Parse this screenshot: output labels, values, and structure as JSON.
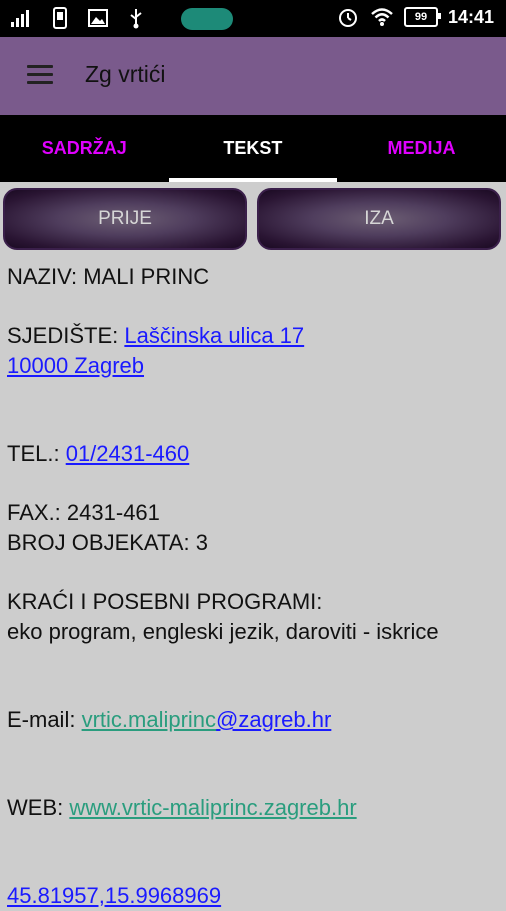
{
  "status_bar": {
    "time": "14:41",
    "battery": "99",
    "icons": [
      "signal-icon",
      "sim-icon",
      "image-icon",
      "usb-icon",
      "alarm-icon",
      "wifi-icon",
      "battery-icon"
    ]
  },
  "app_bar": {
    "title": "Zg vrtići",
    "menu_icon": "hamburger-menu-icon"
  },
  "tabs": [
    {
      "label": "SADRŽAJ",
      "selected": false
    },
    {
      "label": "TEKST",
      "selected": true
    },
    {
      "label": "MEDIJA",
      "selected": false
    }
  ],
  "nav_buttons": {
    "prev": "PRIJE",
    "next": "IZA"
  },
  "details": {
    "name_label": "NAZIV:",
    "name_value": "MALI PRINC",
    "seat_label": "SJEDIŠTE:",
    "seat_line1": "Laščinska ulica 17",
    "seat_line2": "10000 Zagreb",
    "tel_label": "TEL.:",
    "tel_value": "01/2431-460",
    "fax_label": "FAX.:",
    "fax_value": "2431-461",
    "objects_label": "BROJ OBJEKATA:",
    "objects_value": "3",
    "programs_label": "KRAĆI I POSEBNI PROGRAMI:",
    "programs_value": "eko program, engleski jezik, daroviti - iskrice",
    "email_label": "E-mail:",
    "email_part1": "vrtic.maliprinc",
    "email_part2": "@zagreb.hr",
    "web_label": "WEB:",
    "web_value": "www.vrtic-maliprinc.zagreb.hr",
    "coords": "45.81957,15.9968969"
  },
  "colors": {
    "status_bar": "#000000",
    "app_bar": "#7a5a8c",
    "tab_bar": "#000000",
    "tab_accent": "#e000ff",
    "content_bg": "#cdcdcd",
    "link_blue": "#1a1aff",
    "link_green": "#2a9d7e"
  }
}
